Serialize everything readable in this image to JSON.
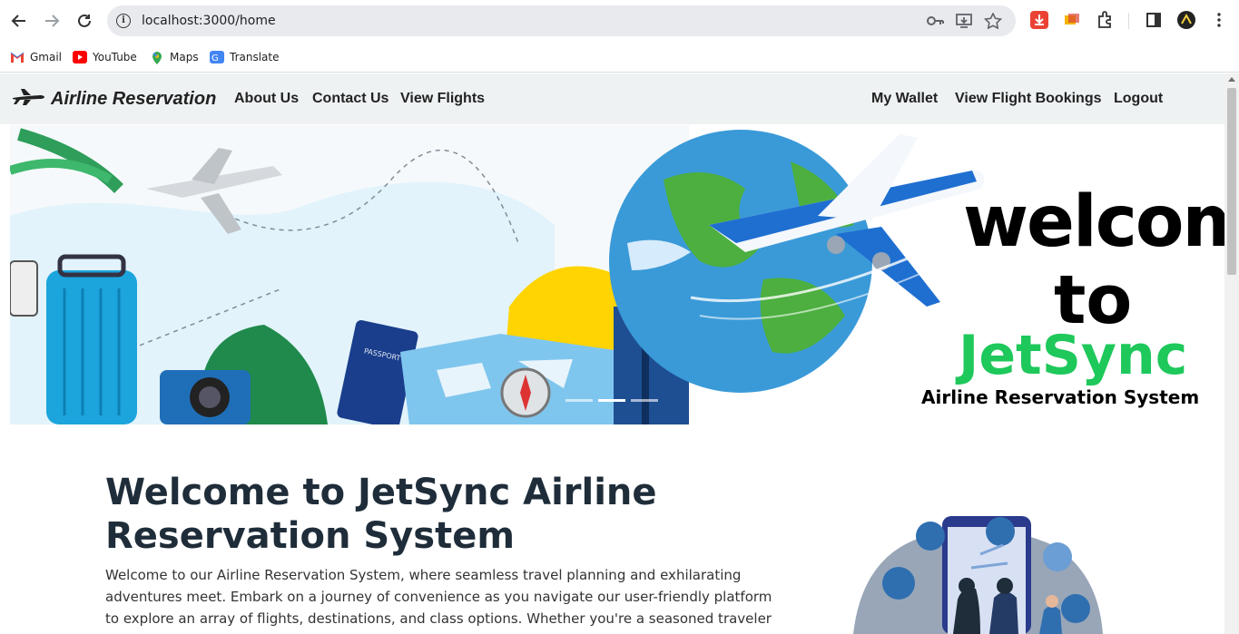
{
  "browser": {
    "url": "localhost:3000/home",
    "bookmarks": [
      {
        "label": "Gmail",
        "icon": "gmail-icon"
      },
      {
        "label": "YouTube",
        "icon": "youtube-icon"
      },
      {
        "label": "Maps",
        "icon": "maps-icon"
      },
      {
        "label": "Translate",
        "icon": "translate-icon"
      }
    ]
  },
  "nav": {
    "brand": "Airline Reservation",
    "left_links": [
      "About Us",
      "Contact Us",
      "View Flights"
    ],
    "right_links": [
      "My Wallet",
      "View Flight Bookings",
      "Logout"
    ]
  },
  "hero": {
    "line1": "welcome",
    "line2": "to",
    "line3": "JetSync",
    "line4": "Airline Reservation System",
    "passport_text": "PASSPORT",
    "colors": {
      "brand_green": "#1ec85b",
      "sky_blue": "#35a0e0",
      "yellow": "#ffd400"
    }
  },
  "main": {
    "title": "Welcome to JetSync Airline Reservation System",
    "paragraph": "Welcome to our Airline Reservation System, where seamless travel planning and exhilarating adventures meet. Embark on a journey of convenience as you navigate our user-friendly platform to explore an array of flights, destinations, and class options. Whether you're a seasoned traveler or a first-time flyer,"
  }
}
